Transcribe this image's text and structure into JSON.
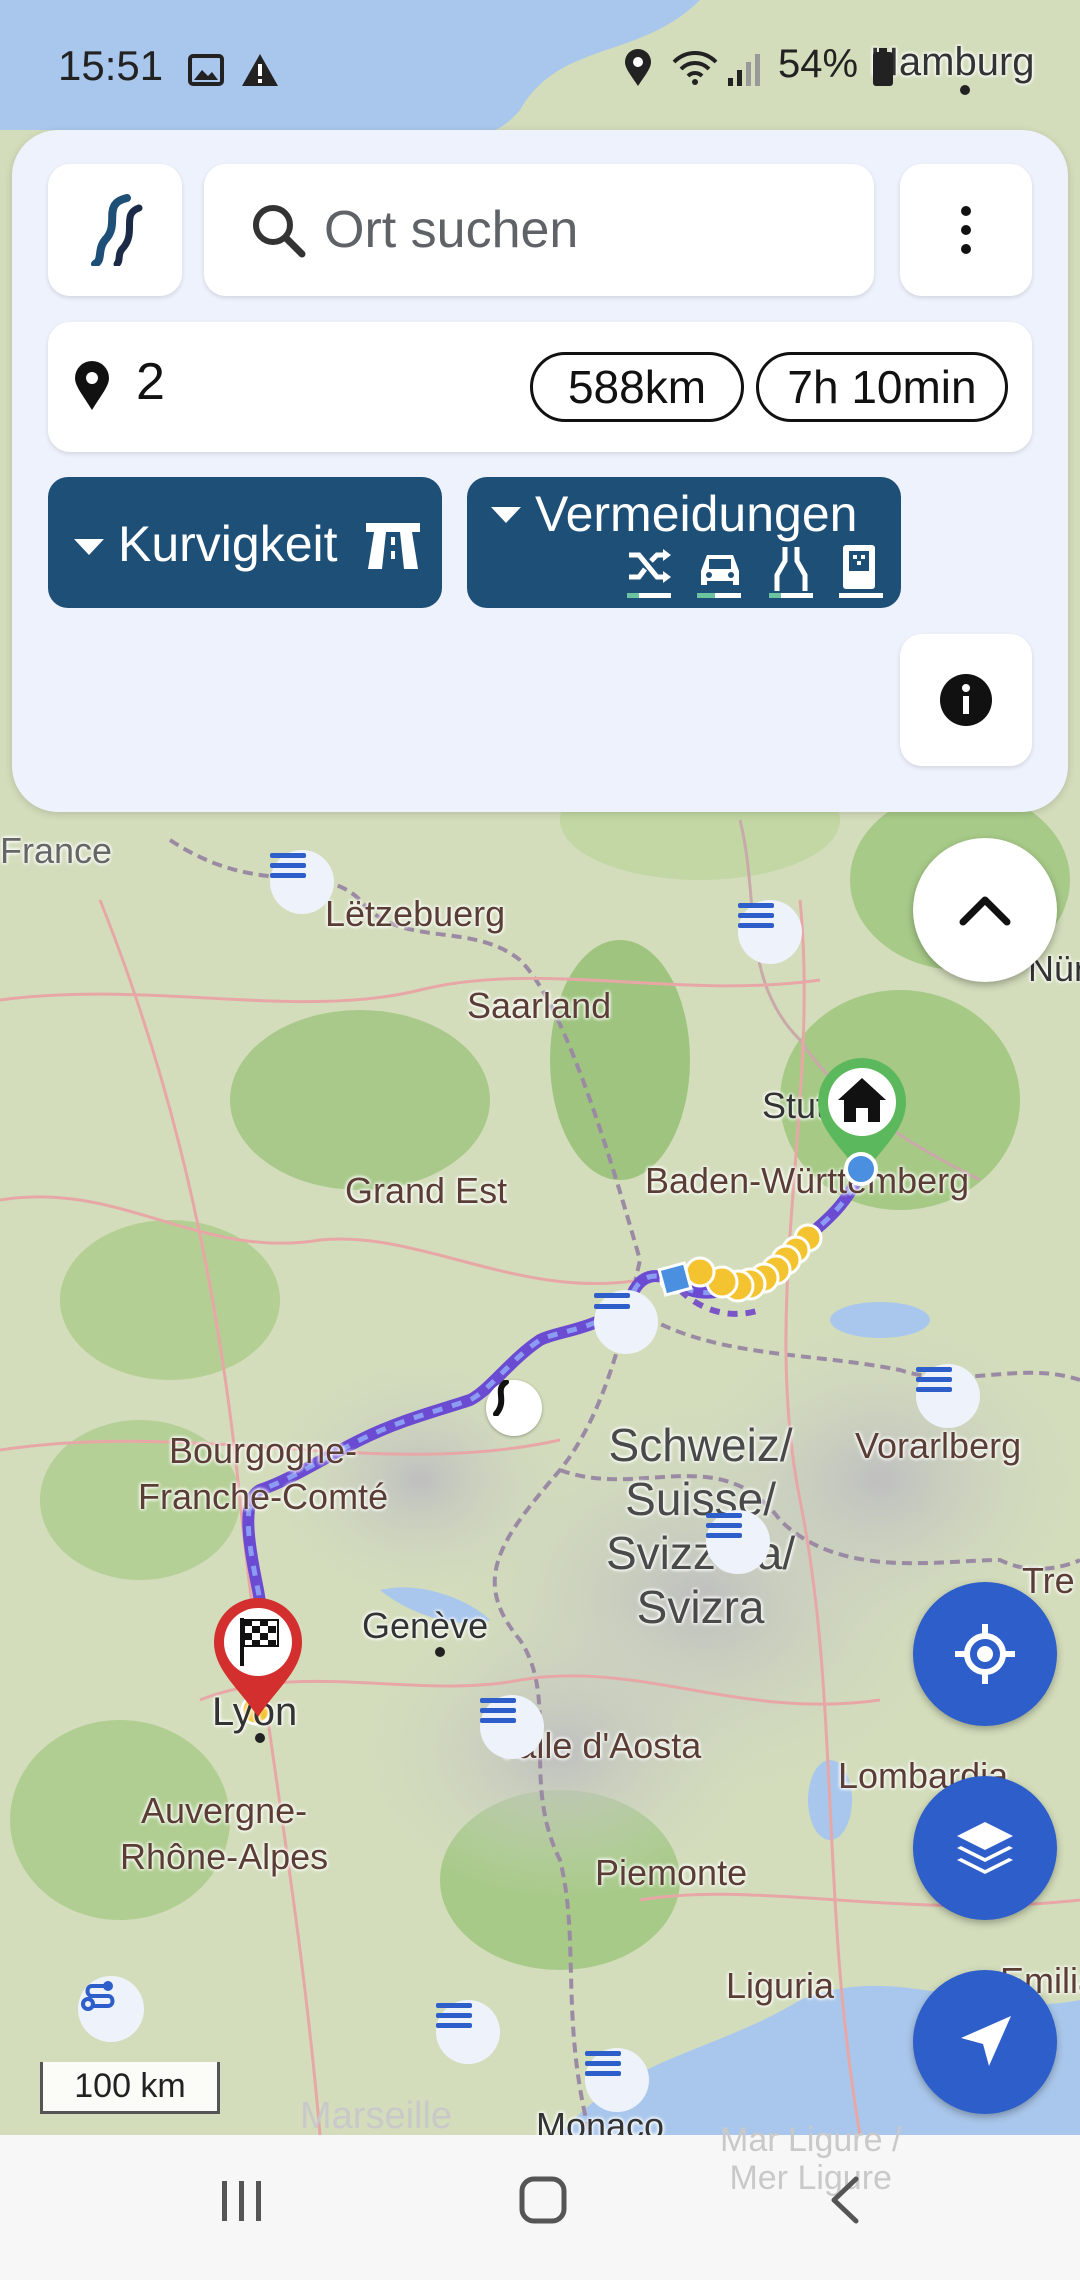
{
  "status": {
    "time": "15:51",
    "battery": "54%",
    "icons": [
      "image-icon",
      "warning-icon",
      "location-icon",
      "wifi-icon",
      "signal-icon",
      "battery-icon"
    ]
  },
  "map": {
    "labels": {
      "hamburg": "Hamburg",
      "france": "France",
      "letzebuerg": "Lëtzebuerg",
      "saarland": "Saarland",
      "stuttgart": "Stuttgart",
      "nurnberg": "Nür",
      "baden": "Baden-Württemberg",
      "grand_est": "Grand Est",
      "schweiz": "Schweiz/\nSuisse/\nSvizzera/\nSvizra",
      "vorarlberg": "Vorarlberg",
      "bourgogne": "Bourgogne-\nFranche-Comté",
      "geneve": "Genève",
      "lyon": "Lyon",
      "valle": "Valle d'Aosta",
      "lombardia": "Lombardia",
      "auvergne": "Auvergne-\nRhône-Alpes",
      "piemonte": "Piemonte",
      "liguria": "Liguria",
      "monaco": "Monaco",
      "marseille": "Marseille",
      "mar_ligure": "Mar Ligure /\nMer Ligure",
      "tre": "Tre",
      "emilia": "Emilia-"
    },
    "scale_label": "100 km"
  },
  "search": {
    "placeholder": "Ort suchen"
  },
  "route": {
    "waypoints": "2",
    "distance": "588km",
    "duration": "7h 10min"
  },
  "chips": {
    "curviness": "Kurvigkeit",
    "avoidances": "Vermeidungen"
  },
  "colors": {
    "accent": "#1e4f77",
    "fab_blue": "#2d5ec9",
    "route": "#6a4bd1",
    "start": "#4caf50",
    "end": "#d32f2f"
  }
}
